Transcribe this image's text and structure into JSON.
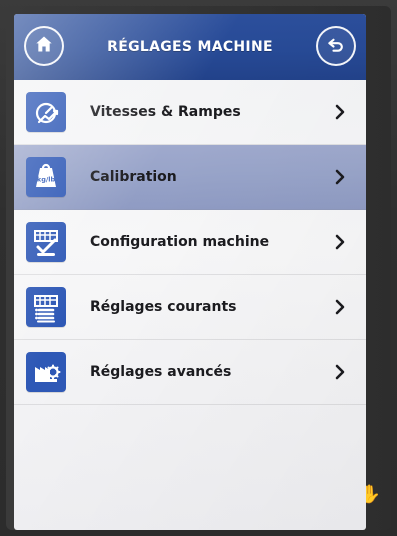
{
  "header": {
    "title": "RÉGLAGES MACHINE",
    "home_icon": "home-icon",
    "back_icon": "back-arrow-icon",
    "bar_color": "#274A96"
  },
  "menu": {
    "items": [
      {
        "label": "Vitesses & Rampes",
        "icon": "speed-ramp-icon",
        "selected": false
      },
      {
        "label": "Calibration",
        "icon": "kg-lb-weight-icon",
        "icon_text": "kg/lb",
        "selected": true
      },
      {
        "label": "Configuration machine",
        "icon": "machine-configuration-icon",
        "selected": false
      },
      {
        "label": "Réglages courants",
        "icon": "current-settings-icon",
        "selected": false
      },
      {
        "label": "Réglages avancés",
        "icon": "advanced-settings-icon",
        "selected": false
      }
    ]
  },
  "colors": {
    "accent_blue": "#2E58B6",
    "selected_row": "#98A4C9",
    "text": "#1B1B1F"
  }
}
